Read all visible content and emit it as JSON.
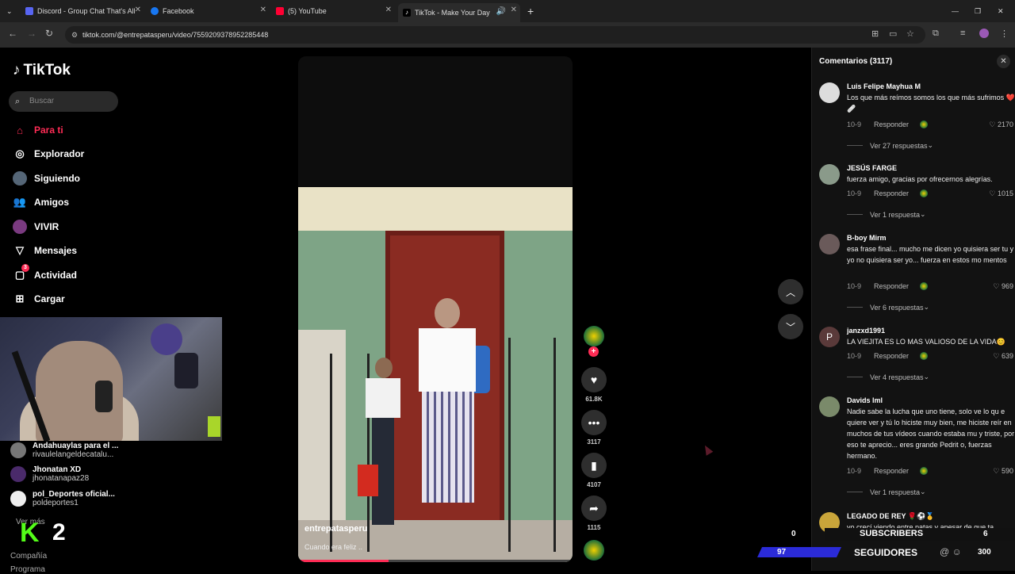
{
  "browser": {
    "tabs": [
      {
        "title": "Discord - Group Chat That's All",
        "color": "#5865f2"
      },
      {
        "title": "Facebook",
        "color": "#1877f2"
      },
      {
        "title": "(5) YouTube",
        "color": "#ff0033"
      },
      {
        "title": "TikTok - Make Your Day",
        "color": "#ffffff"
      }
    ],
    "url": "tiktok.com/@entrepatasperu/video/7559209378952285448"
  },
  "sidebar": {
    "logo": "TikTok",
    "search_placeholder": "Buscar",
    "nav": [
      {
        "label": "Para ti",
        "icon": "home-icon"
      },
      {
        "label": "Explorador",
        "icon": "compass-icon"
      },
      {
        "label": "Siguiendo",
        "icon": "following-icon"
      },
      {
        "label": "Amigos",
        "icon": "friends-icon"
      },
      {
        "label": "VIVIR",
        "icon": "live-icon"
      },
      {
        "label": "Mensajes",
        "icon": "messages-icon"
      },
      {
        "label": "Actividad",
        "icon": "activity-icon"
      },
      {
        "label": "Cargar",
        "icon": "upload-icon"
      }
    ],
    "activity_badge": "3",
    "following": [
      {
        "name": "Andahuaylas para el ...",
        "handle": "rivaulelangeldecatalu..."
      },
      {
        "name": "Jhonatan XD",
        "handle": "jhonatanapaz28"
      },
      {
        "name": "pol_Deportes oficial...",
        "handle": "poldeportes1"
      }
    ],
    "ver_mas": "Ver más",
    "compania": "Compañía",
    "programa": "Programa"
  },
  "stream_overlay": {
    "kick_logo": "K",
    "kick_number": "2",
    "subs_label": "SUBSCRIBERS",
    "subs_left": "0",
    "subs_right": "6",
    "followers_label": "SEGUIDORES",
    "followers_left": "97",
    "followers_right": "300"
  },
  "video": {
    "author": "entrepatasperu",
    "caption": "Cuando era feliz ..",
    "progress_fraction": 0.33,
    "likes": "61.8K",
    "comments": "3117",
    "saves": "4107",
    "shares": "1115"
  },
  "comments_panel": {
    "title": "Comentarios (3117)",
    "comments": [
      {
        "user": "Luis Felipe Mayhua M",
        "text": "Los que más reímos somos los que más sufrimos ❤️🩹",
        "date": "10-9",
        "reply": "Responder",
        "likes": "2170",
        "replies": "Ver 27 respuestas"
      },
      {
        "user": "JESÚS FARGE",
        "text": "fuerza amigo, gracias por ofrecernos alegrías.",
        "date": "10-9",
        "reply": "Responder",
        "likes": "1015",
        "replies": "Ver 1 respuesta"
      },
      {
        "user": "B-boy Mirm",
        "text": "esa frase final... mucho me dicen yo quisiera ser tu y yo no quisiera ser yo... fuerza en estos mo mentos",
        "date": "10-9",
        "reply": "Responder",
        "likes": "969",
        "replies": "Ver 6 respuestas"
      },
      {
        "user": "janzxd1991",
        "avatar_letter": "P",
        "text": "LA VIEJITA ES LO MAS VALIOSO DE LA VIDA😊",
        "date": "10-9",
        "reply": "Responder",
        "likes": "639",
        "replies": "Ver 4 respuestas"
      },
      {
        "user": "Davids lml",
        "text": "Nadie sabe la lucha que uno tiene, solo ve lo qu e quiere ver y tú lo hiciste muy bien, me hiciste reír en muchos de tus vídeos cuando estaba mu y triste, por eso te aprecio... eres grande Pedrit o, fuerzas hermano.",
        "date": "10-9",
        "reply": "Responder",
        "likes": "590",
        "replies": "Ver 1 respuesta"
      },
      {
        "user": "LEGADO DE REY 🌹⚽🥇",
        "text": "yo crecí viendo entre patas y apesar de que ta"
      }
    ]
  }
}
